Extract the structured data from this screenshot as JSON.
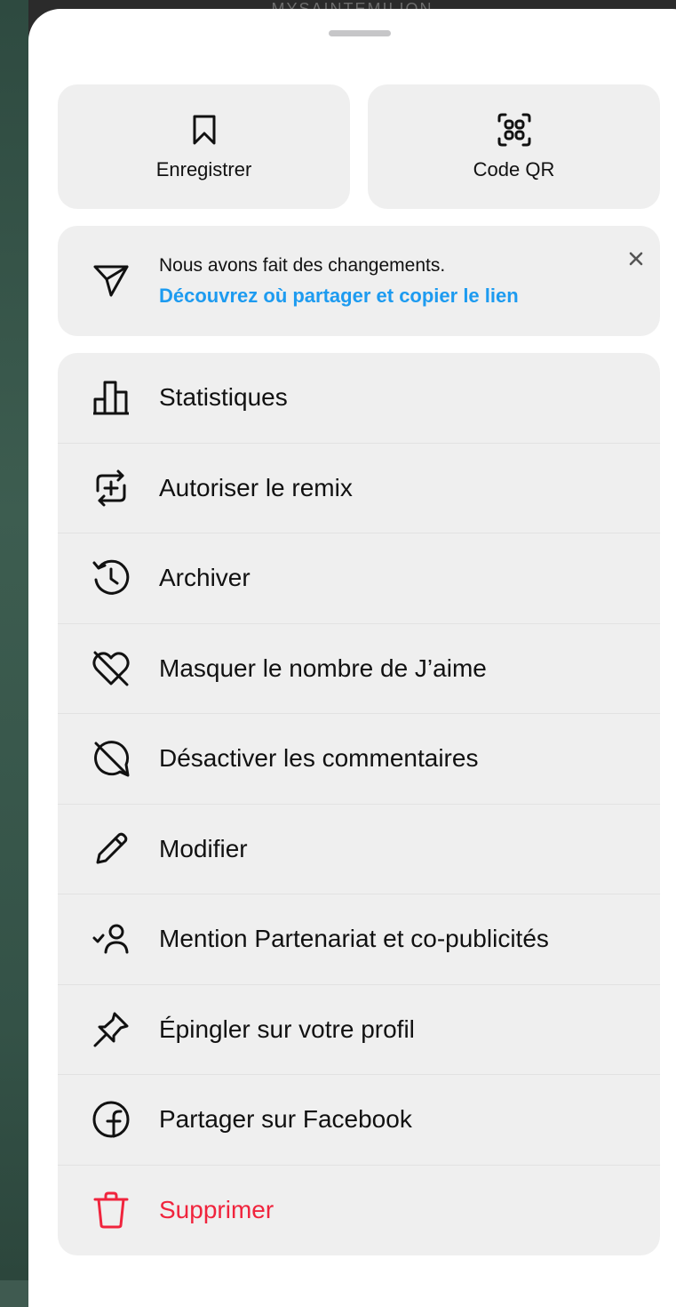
{
  "background": {
    "header_text": "MYSAINTEMILION"
  },
  "actions": [
    {
      "label": "Enregistrer",
      "icon": "bookmark-icon"
    },
    {
      "label": "Code QR",
      "icon": "qr-code-icon"
    }
  ],
  "notice": {
    "icon": "send-icon",
    "text": "Nous avons fait des changements.",
    "link": "Découvrez où partager et copier le lien"
  },
  "menu": {
    "items": [
      {
        "label": "Statistiques",
        "icon": "bar-chart-icon"
      },
      {
        "label": "Autoriser le remix",
        "icon": "remix-icon"
      },
      {
        "label": "Archiver",
        "icon": "archive-history-icon"
      },
      {
        "label": "Masquer le nombre de J’aime",
        "icon": "heart-off-icon"
      },
      {
        "label": "Désactiver les commentaires",
        "icon": "comments-off-icon"
      },
      {
        "label": "Modifier",
        "icon": "pencil-icon"
      },
      {
        "label": "Mention Partenariat et co-publicités",
        "icon": "partner-tag-icon"
      },
      {
        "label": "Épingler sur votre profil",
        "icon": "pin-icon"
      },
      {
        "label": "Partager sur Facebook",
        "icon": "facebook-icon"
      },
      {
        "label": "Supprimer",
        "icon": "trash-icon"
      }
    ]
  },
  "colors": {
    "link": "#1d9bf0",
    "danger": "#f0243d",
    "panel": "#efefef"
  }
}
